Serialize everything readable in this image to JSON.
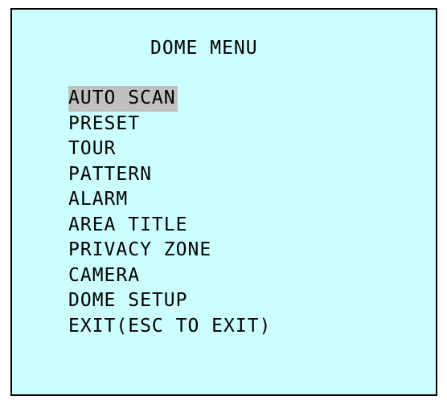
{
  "menu": {
    "title": "DOME MENU",
    "selected_index": 0,
    "items": [
      {
        "label": "AUTO SCAN"
      },
      {
        "label": "PRESET"
      },
      {
        "label": "TOUR"
      },
      {
        "label": "PATTERN"
      },
      {
        "label": "ALARM"
      },
      {
        "label": "AREA TITLE"
      },
      {
        "label": "PRIVACY ZONE"
      },
      {
        "label": "CAMERA"
      },
      {
        "label": "DOME SETUP"
      },
      {
        "label": "EXIT(ESC TO EXIT)"
      }
    ]
  },
  "colors": {
    "background": "#ccffff",
    "highlight": "#c0c0c0",
    "text": "#000000",
    "border": "#000000"
  }
}
